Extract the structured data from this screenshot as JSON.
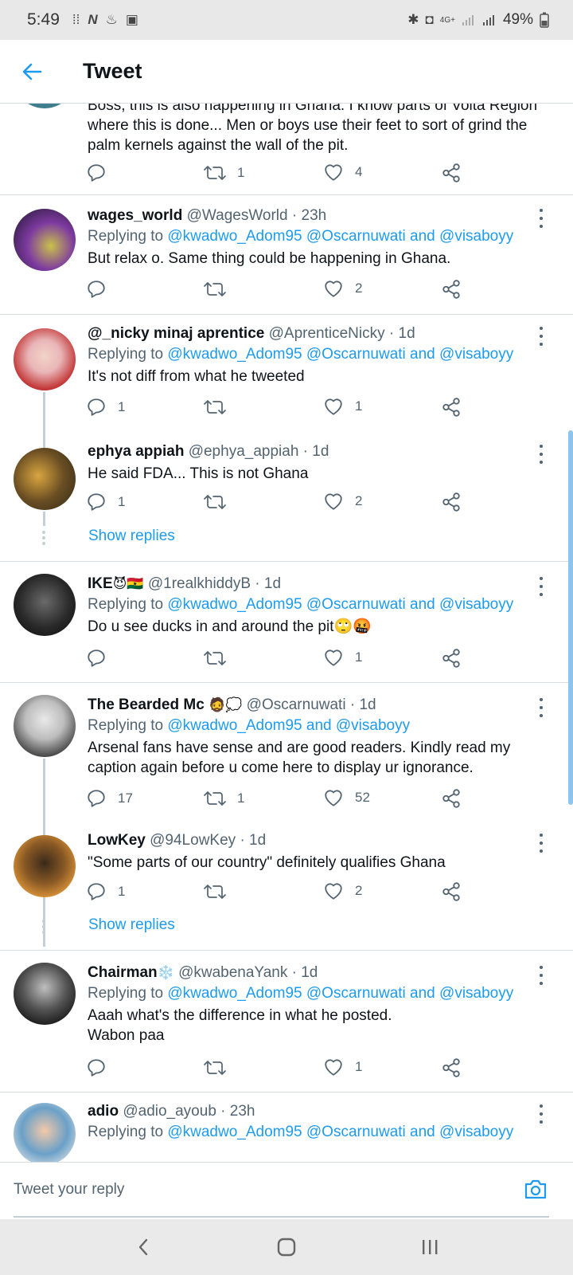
{
  "status_bar": {
    "time": "5:49",
    "network": "4G+",
    "battery": "49%"
  },
  "header": {
    "title": "Tweet"
  },
  "partial_tweet": {
    "text": "Boss, this is also happening in Ghana. I know parts of Volta Region where this is done... Men or boys use their feet to sort of grind the palm kernels against the wall of the pit.",
    "retweets": "1",
    "likes": "4"
  },
  "tweets": [
    {
      "name": "wages_world",
      "handle": "@WagesWorld",
      "time": "· 23h",
      "replying_prefix": "Replying to",
      "replying_links": "@kwadwo_Adom95 @Oscarnuwati and @visaboyy",
      "text": "But relax o. Same thing could be happening in Ghana.",
      "replies": "",
      "retweets": "",
      "likes": "2"
    },
    {
      "name": "@_nicky minaj aprentice",
      "handle": "@AprenticeNicky",
      "time": "· 1d",
      "replying_prefix": "Replying to",
      "replying_links": "@kwadwo_Adom95 @Oscarnuwati and @visaboyy",
      "text": "It's not diff from what he tweeted",
      "replies": "1",
      "retweets": "",
      "likes": "1"
    },
    {
      "name": "ephya appiah",
      "handle": "@ephya_appiah",
      "time": "· 1d",
      "text": "He said FDA... This is not Ghana",
      "replies": "1",
      "retweets": "",
      "likes": "2"
    },
    {
      "name": "IKE",
      "name_emoji": "😈🇬🇭",
      "handle": "@1realkhiddyB",
      "time": "· 1d",
      "replying_prefix": "Replying to",
      "replying_links": "@kwadwo_Adom95 @Oscarnuwati and @visaboyy",
      "text": "Do u see ducks in and around the pit🙄🤬",
      "replies": "",
      "retweets": "",
      "likes": "1"
    },
    {
      "name": "The Bearded Mc",
      "name_emoji": "🧔💭",
      "handle": "@Oscarnuwati",
      "time": "· 1d",
      "replying_prefix": "Replying to",
      "replying_links": "@kwadwo_Adom95 and @visaboyy",
      "text": "Arsenal fans have sense and are good readers. Kindly read my caption again before u come here to display ur ignorance.",
      "replies": "17",
      "retweets": "1",
      "likes": "52"
    },
    {
      "name": "LowKey",
      "handle": "@94LowKey",
      "time": "· 1d",
      "text": "\"Some parts of our country\" definitely qualifies Ghana",
      "replies": "1",
      "retweets": "",
      "likes": "2"
    },
    {
      "name": "Chairman",
      "name_emoji": "❄️",
      "handle": "@kwabenaYank",
      "time": "· 1d",
      "replying_prefix": "Replying to",
      "replying_links": "@kwadwo_Adom95 @Oscarnuwati and @visaboyy",
      "text": "Aaah what's the difference in what he posted.\nWabon paa",
      "replies": "",
      "retweets": "",
      "likes": "1"
    },
    {
      "name": "adio",
      "handle": "@adio_ayoub",
      "time": "· 23h",
      "replying_prefix": "Replying to",
      "replying_links": "@kwadwo_Adom95 @Oscarnuwati and @visaboyy"
    }
  ],
  "show_replies_label": "Show replies",
  "reply_bar": {
    "placeholder": "Tweet your reply"
  },
  "colors": {
    "accent": "#1d9bf0",
    "secondary_text": "#536471",
    "divider": "#d8dde1"
  },
  "icons": [
    "back-arrow-icon",
    "reply-icon",
    "retweet-icon",
    "heart-icon",
    "share-icon",
    "more-icon",
    "camera-icon"
  ]
}
